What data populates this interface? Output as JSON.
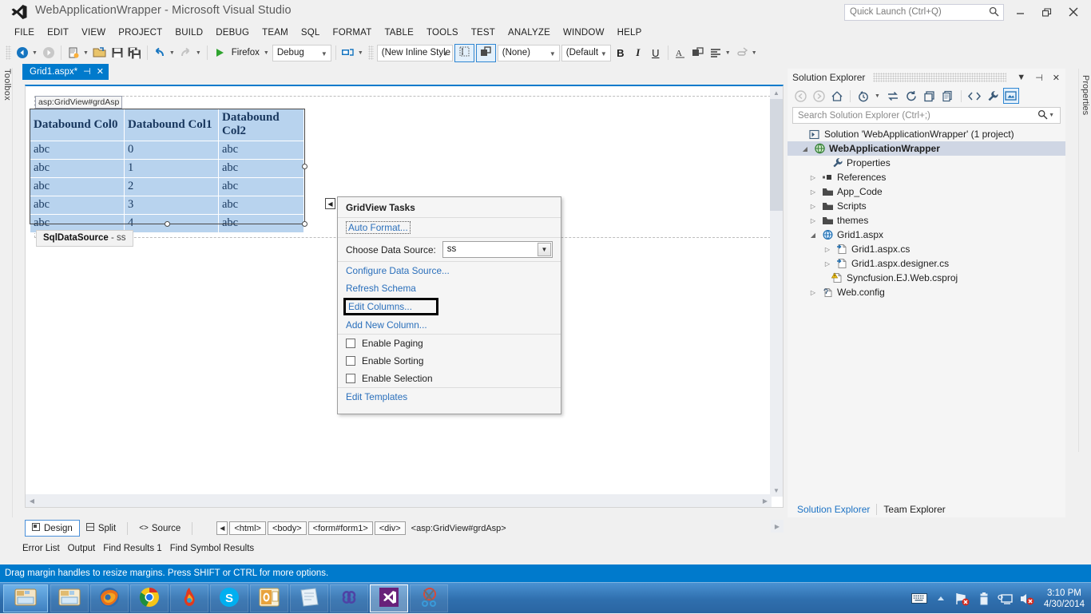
{
  "window": {
    "title": "WebApplicationWrapper - Microsoft Visual Studio",
    "logo_icon": "visual-studio-logo",
    "quick_launch_placeholder": "Quick Launch (Ctrl+Q)",
    "minimize_label": "Minimize",
    "restore_label": "Restore",
    "close_label": "Close"
  },
  "menu": {
    "items": [
      {
        "label": "FILE"
      },
      {
        "label": "EDIT"
      },
      {
        "label": "VIEW"
      },
      {
        "label": "PROJECT"
      },
      {
        "label": "BUILD"
      },
      {
        "label": "DEBUG"
      },
      {
        "label": "TEAM"
      },
      {
        "label": "SQL"
      },
      {
        "label": "FORMAT"
      },
      {
        "label": "TABLE"
      },
      {
        "label": "TOOLS"
      },
      {
        "label": "TEST"
      },
      {
        "label": "ANALYZE"
      },
      {
        "label": "WINDOW"
      },
      {
        "label": "HELP"
      }
    ]
  },
  "toolbar": {
    "navigate_back_icon": "navigate-back-icon",
    "navigate_forward_icon": "navigate-forward-icon",
    "new_item_icon": "new-item-icon",
    "open_file_icon": "open-file-icon",
    "save_icon": "save-icon",
    "save_all_icon": "save-all-icon",
    "undo_icon": "undo-icon",
    "redo_icon": "redo-icon",
    "start_debug_label": "Firefox",
    "config_label": "Debug",
    "attach_icon": "attach-to-process-icon",
    "style_value": "(New Inline Style",
    "block_format_value": "(None)",
    "font_value": "(Default",
    "bold_label": "B",
    "italic_label": "I",
    "underline_label": "U",
    "foreground_color_icon": "font-color-icon",
    "background_color_icon": "background-color-icon",
    "justify_icon": "align-left-icon",
    "hyperlink_icon": "hyperlink-icon",
    "overflow_icon": "toolbar-overflow-icon",
    "select_tag_icon": "select-tag-icon",
    "positioning_icon": "absolute-position-icon"
  },
  "document_tab": {
    "label": "Grid1.aspx*",
    "pin_icon": "pin-icon",
    "close_icon": "close-icon"
  },
  "left_strip": {
    "toolbox_label": "Toolbox"
  },
  "right_strip": {
    "properties_label": "Properties"
  },
  "designer": {
    "control_tag": "asp:GridView#grdAsp",
    "smart_tag_icon": "smart-tag-arrow-icon",
    "gridview": {
      "headers": [
        "Databound Col0",
        "Databound Col1",
        "Databound Col2"
      ],
      "rows": [
        [
          "abc",
          "0",
          "abc"
        ],
        [
          "abc",
          "1",
          "abc"
        ],
        [
          "abc",
          "2",
          "abc"
        ],
        [
          "abc",
          "3",
          "abc"
        ],
        [
          "abc",
          "4",
          "abc"
        ]
      ]
    },
    "datasource_label": "SqlDataSource",
    "datasource_name": "- ss"
  },
  "gridview_tasks": {
    "title": "GridView Tasks",
    "auto_format": "Auto Format...",
    "choose_data_source_label": "Choose Data Source:",
    "data_source_value": "ss",
    "dropdown_icon": "chevron-down-icon",
    "configure_data_source": "Configure Data Source...",
    "refresh_schema": "Refresh Schema",
    "edit_columns": "Edit Columns...",
    "add_new_column": "Add New Column...",
    "enable_paging": "Enable Paging",
    "enable_sorting": "Enable Sorting",
    "enable_selection": "Enable Selection",
    "edit_templates": "Edit Templates"
  },
  "view_bar": {
    "design_label": "Design",
    "split_label": "Split",
    "source_label": "Source",
    "nav_icon": "breadcrumb-nav-icon",
    "breadcrumbs": [
      "<html>",
      "<body>",
      "<form#form1>",
      "<div>",
      "<asp:GridView#grdAsp>"
    ]
  },
  "bottom_tabs": {
    "items": [
      "Error List",
      "Output",
      "Find Results 1",
      "Find Symbol Results"
    ]
  },
  "solution_explorer": {
    "title": "Solution Explorer",
    "dropdown_icon": "chevron-down-icon",
    "pin_icon": "pin-icon",
    "close_icon": "close-icon",
    "toolbar": {
      "back_icon": "back-icon",
      "forward_icon": "forward-icon",
      "home_icon": "home-icon",
      "pending_changes_icon": "pending-changes-icon",
      "sync_icon": "sync-with-active-document-icon",
      "refresh_icon": "refresh-icon",
      "collapse_all_icon": "collapse-all-icon",
      "show_all_files_icon": "show-all-files-icon",
      "view_code_icon": "view-code-icon",
      "properties_icon": "properties-wrench-icon",
      "preview_icon": "preview-selected-items-icon"
    },
    "search_placeholder": "Search Solution Explorer (Ctrl+;)",
    "search_icon": "search-icon",
    "tree": [
      {
        "label": "Solution 'WebApplicationWrapper' (1 project)",
        "icon": "solution-icon",
        "indent": 0,
        "twisty": "",
        "selected": false,
        "bold": false
      },
      {
        "label": "WebApplicationWrapper",
        "icon": "web-project-icon",
        "indent": 1,
        "twisty": "expanded",
        "selected": true,
        "bold": true
      },
      {
        "label": "Properties",
        "icon": "properties-wrench-icon",
        "indent": 2,
        "twisty": "",
        "selected": false,
        "bold": false
      },
      {
        "label": "References",
        "icon": "references-icon",
        "indent": 2,
        "twisty": "collapsed",
        "selected": false,
        "bold": false
      },
      {
        "label": "App_Code",
        "icon": "folder-icon",
        "indent": 2,
        "twisty": "collapsed",
        "selected": false,
        "bold": false
      },
      {
        "label": "Scripts",
        "icon": "folder-icon",
        "indent": 2,
        "twisty": "collapsed",
        "selected": false,
        "bold": false
      },
      {
        "label": "themes",
        "icon": "folder-icon",
        "indent": 2,
        "twisty": "collapsed",
        "selected": false,
        "bold": false
      },
      {
        "label": "Grid1.aspx",
        "icon": "web-form-icon",
        "indent": 2,
        "twisty": "expanded",
        "selected": false,
        "bold": false
      },
      {
        "label": "Grid1.aspx.cs",
        "icon": "csharp-file-icon",
        "indent": 3,
        "twisty": "collapsed",
        "selected": false,
        "bold": false
      },
      {
        "label": "Grid1.aspx.designer.cs",
        "icon": "csharp-file-icon",
        "indent": 3,
        "twisty": "collapsed",
        "selected": false,
        "bold": false
      },
      {
        "label": "Syncfusion.EJ.Web.csproj",
        "icon": "warning-file-icon",
        "indent": 2,
        "twisty": "",
        "selected": false,
        "bold": false
      },
      {
        "label": "Web.config",
        "icon": "config-file-icon",
        "indent": 2,
        "twisty": "collapsed",
        "selected": false,
        "bold": false
      }
    ],
    "footer_tabs": [
      {
        "label": "Solution Explorer",
        "active": true
      },
      {
        "label": "Team Explorer",
        "active": false
      }
    ]
  },
  "status_bar": {
    "message": "Drag margin handles to resize margins. Press SHIFT or CTRL for more options.",
    "accent_color": "#007acc"
  },
  "taskbar": {
    "start_icon": "windows-explorer-icon",
    "items": [
      {
        "icon": "file-explorer-icon",
        "active": false
      },
      {
        "icon": "firefox-icon",
        "active": false
      },
      {
        "icon": "chrome-icon",
        "active": false
      },
      {
        "icon": "firefox-dev-icon",
        "active": false
      },
      {
        "icon": "skype-icon",
        "active": false
      },
      {
        "icon": "outlook-icon",
        "active": false
      },
      {
        "icon": "notepad-icon",
        "active": false
      },
      {
        "icon": "visual-studio-infinity-icon",
        "active": false
      },
      {
        "icon": "visual-studio-icon",
        "active": true
      },
      {
        "icon": "snipping-tool-icon",
        "active": false
      }
    ],
    "tray": {
      "keyboard_icon": "keyboard-icon",
      "show_hidden_icon": "show-hidden-icons-icon",
      "network_icon": "network-error-icon",
      "battery_icon": "battery-icon",
      "display_icon": "display-icon",
      "volume_icon": "volume-muted-icon",
      "time": "3:10 PM",
      "date": "4/30/2014"
    }
  }
}
